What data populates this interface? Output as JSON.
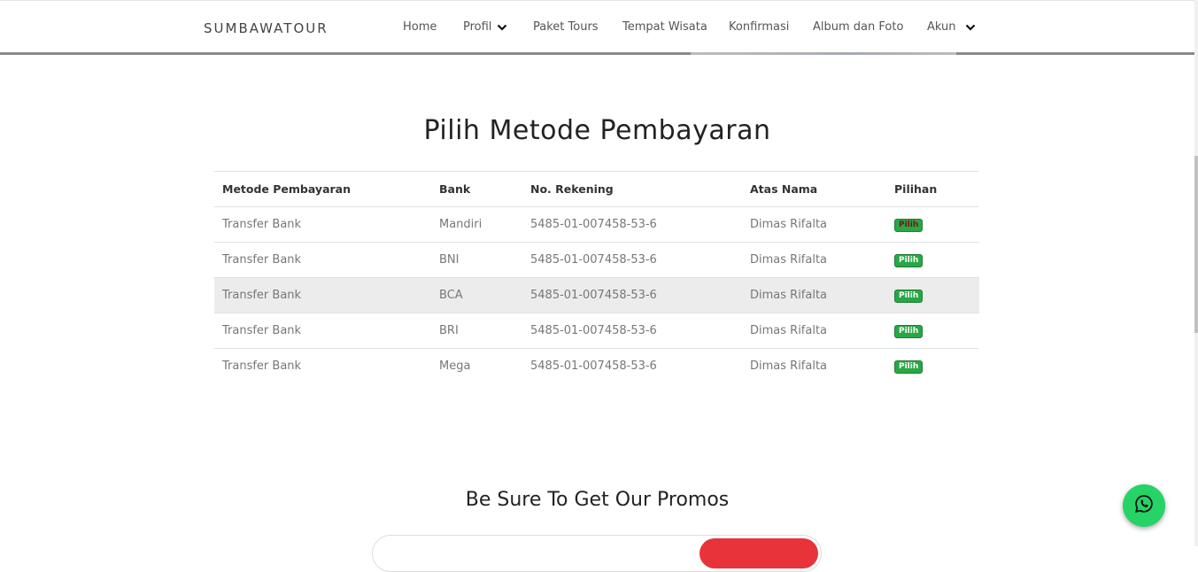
{
  "navbar": {
    "brand": "SUMBAWATOUR",
    "items": [
      {
        "label": "Home"
      },
      {
        "label": "Profil"
      },
      {
        "label": "Paket Tours"
      },
      {
        "label": "Tempat Wisata"
      },
      {
        "label": "Konfirmasi"
      },
      {
        "label": "Album dan Foto"
      },
      {
        "label": "Akun"
      }
    ]
  },
  "main": {
    "title": "Pilih Metode Pembayaran",
    "table": {
      "headers": [
        "Metode Pembayaran",
        "Bank",
        "No. Rekening",
        "Atas Nama",
        "Pilihan"
      ],
      "rows": [
        [
          "Transfer Bank",
          "Mandiri",
          "5485-01-007458-53-6",
          "Dimas Rifalta",
          "Pilih"
        ],
        [
          "Transfer Bank",
          "BNI",
          "5485-01-007458-53-6",
          "Dimas Rifalta",
          "Pilih"
        ],
        [
          "Transfer Bank",
          "BCA",
          "5485-01-007458-53-6",
          "Dimas Rifalta",
          "Pilih"
        ],
        [
          "Transfer Bank",
          "BRI",
          "5485-01-007458-53-6",
          "Dimas Rifalta",
          "Pilih"
        ],
        [
          "Transfer Bank",
          "Mega",
          "5485-01-007458-53-6",
          "Dimas Rifalta",
          "Pilih"
        ]
      ]
    }
  },
  "promo": {
    "title": "Be Sure To Get Our Promos"
  },
  "icons": {
    "dropdown": "chevron-down-icon",
    "whatsapp": "whatsapp-icon"
  },
  "colors": {
    "badge": "#28a745",
    "whatsapp": "#25d366",
    "subscribe_button": "#e8333a"
  }
}
